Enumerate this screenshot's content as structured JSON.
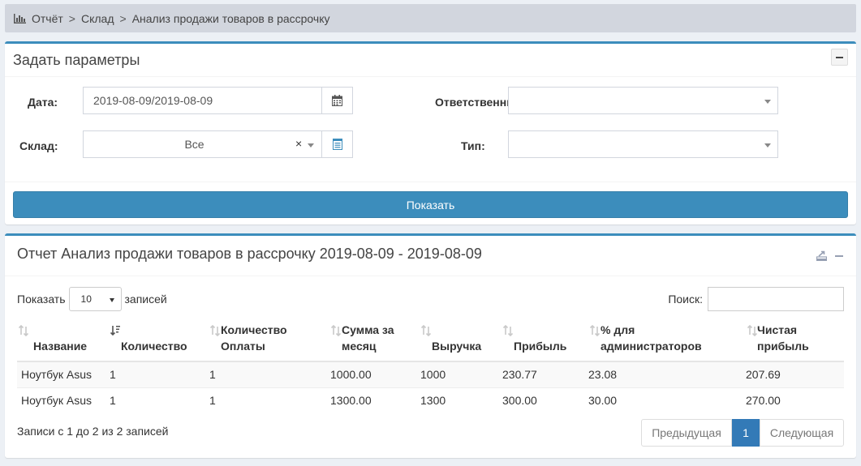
{
  "breadcrumb": {
    "icon": "bar-chart-icon",
    "items": [
      "Отчёт",
      "Склад",
      "Анализ продажи товаров в рассрочку"
    ],
    "separator": ">"
  },
  "params": {
    "title": "Задать параметры",
    "date_label": "Дата:",
    "date_value": "2019-08-09/2019-08-09",
    "warehouse_label": "Склад:",
    "warehouse_value": "Все",
    "clear_symbol": "×",
    "responsible_label": "Ответственни",
    "responsible_value": "",
    "type_label": "Тип:",
    "type_value": "",
    "show_button": "Показать"
  },
  "report": {
    "title": "Отчет Анализ продажи товаров в рассрочку 2019-08-09 - 2019-08-09",
    "length_prefix": "Показать",
    "length_value": "10",
    "length_suffix": "записей",
    "search_label": "Поиск:",
    "search_value": "",
    "columns": [
      {
        "line1": "",
        "line2": "Название"
      },
      {
        "line1": "",
        "line2": "Количество"
      },
      {
        "line1": "Количество",
        "line2": "Оплаты"
      },
      {
        "line1": "Сумма за",
        "line2": "месяц"
      },
      {
        "line1": "",
        "line2": "Выручка"
      },
      {
        "line1": "",
        "line2": "Прибыль"
      },
      {
        "line1": "% для",
        "line2": "администраторов"
      },
      {
        "line1": "Чистая",
        "line2": "прибыль"
      }
    ],
    "rows": [
      [
        "Ноутбук Asus",
        "1",
        "1",
        "1000.00",
        "1000",
        "230.77",
        "23.08",
        "207.69"
      ],
      [
        "Ноутбук Asus",
        "1",
        "1",
        "1300.00",
        "1300",
        "300.00",
        "30.00",
        "270.00"
      ]
    ],
    "info": "Записи с 1 до 2 из 2 записей",
    "pager": {
      "prev": "Предыдущая",
      "current": "1",
      "next": "Следующая"
    }
  },
  "colors": {
    "accent": "#3c8dbc",
    "page_bg": "#ecf0f5",
    "breadcrumb_bg": "#d2d6de",
    "active_page": "#337ab7"
  }
}
